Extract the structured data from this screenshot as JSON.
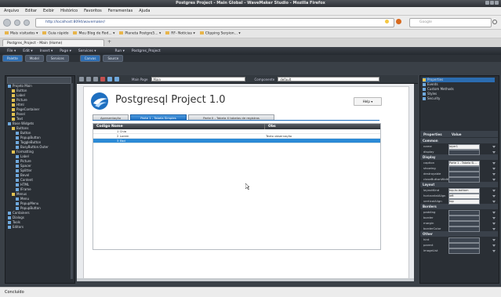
{
  "window": {
    "title": "Postgres Project - Main Global - WaveMaker Studio - Mozilla Firefox"
  },
  "menu": [
    "Arquivo",
    "Editar",
    "Exibir",
    "Histórico",
    "Favoritos",
    "Ferramentas",
    "Ajuda"
  ],
  "nav": {
    "url": "http://localhost:8094/wavemaker/",
    "search_placeholder": "Google"
  },
  "bookmarks": [
    "Mais visitados ▾",
    "Guia rápido",
    "Meu Blog de Rod... ▾",
    "Planeta Postgre5... ▾",
    "RF- Notícias ▾",
    "Clipping Serpion... ▾"
  ],
  "browser_tab": "Postgres_Project - Main (Home)",
  "studio": {
    "menus": [
      "File ▾",
      "Edit ▾",
      "Insert ▾",
      "Page ▾",
      "Services ▾",
      "Run ▾",
      "Postgres_Project"
    ],
    "tabs": [
      "Palette",
      "Model",
      "Services",
      "Canvas",
      "Source"
    ],
    "toolbar": {
      "page_label": "Main Page",
      "page_value": "Main",
      "theme_label": "Componente",
      "theme_value": "default"
    }
  },
  "tree": [
    {
      "label": "Projeto Main",
      "level": 0,
      "color": "#6fa8dc"
    },
    {
      "label": "Button",
      "level": 1,
      "color": "#e0c050"
    },
    {
      "label": "Label",
      "level": 1,
      "color": "#e0c050"
    },
    {
      "label": "Picture",
      "level": 1,
      "color": "#e0c050"
    },
    {
      "label": "Html",
      "level": 1,
      "color": "#e0c050"
    },
    {
      "label": "PageContainer",
      "level": 1,
      "color": "#e0c050"
    },
    {
      "label": "Panel",
      "level": 1,
      "color": "#e0c050"
    },
    {
      "label": "Text",
      "level": 1,
      "color": "#e0c050"
    },
    {
      "label": "Base Widgets",
      "level": 0,
      "color": "#6fa8dc"
    },
    {
      "label": "Buttons",
      "level": 1,
      "color": "#e0c050"
    },
    {
      "label": "Button",
      "level": 2,
      "color": "#6fa8dc"
    },
    {
      "label": "PopupButton",
      "level": 2,
      "color": "#6fa8dc"
    },
    {
      "label": "ToggleButton",
      "level": 2,
      "color": "#6fa8dc"
    },
    {
      "label": "BusyButton.Outer",
      "level": 2,
      "color": "#6fa8dc"
    },
    {
      "label": "Formatting",
      "level": 1,
      "color": "#e0c050"
    },
    {
      "label": "Label",
      "level": 2,
      "color": "#6fa8dc"
    },
    {
      "label": "Picture",
      "level": 2,
      "color": "#6fa8dc"
    },
    {
      "label": "Spacer",
      "level": 2,
      "color": "#6fa8dc"
    },
    {
      "label": "Splitter",
      "level": 2,
      "color": "#6fa8dc"
    },
    {
      "label": "Bevel",
      "level": 2,
      "color": "#6fa8dc"
    },
    {
      "label": "Content",
      "level": 2,
      "color": "#6fa8dc"
    },
    {
      "label": "HTML",
      "level": 2,
      "color": "#6fa8dc"
    },
    {
      "label": "IFrame",
      "level": 2,
      "color": "#6fa8dc"
    },
    {
      "label": "Menus",
      "level": 1,
      "color": "#e0c050"
    },
    {
      "label": "Menu",
      "level": 2,
      "color": "#6fa8dc"
    },
    {
      "label": "PopupMenu",
      "level": 2,
      "color": "#6fa8dc"
    },
    {
      "label": "PopupButton",
      "level": 2,
      "color": "#6fa8dc"
    },
    {
      "label": "Containers",
      "level": 0,
      "color": "#6fa8dc"
    },
    {
      "label": "Dialogs",
      "level": 0,
      "color": "#6fa8dc"
    },
    {
      "label": "Tools",
      "level": 0,
      "color": "#6fa8dc"
    },
    {
      "label": "Editors",
      "level": 0,
      "color": "#6fa8dc"
    }
  ],
  "app": {
    "title": "Postgresql Project 1.0",
    "help": "Help ▾",
    "tabs": [
      "Apresentação",
      "Parte 1 - Tabela Simples",
      "Parte II - Tabela X tabelas de registros"
    ],
    "active_tab": 1,
    "grid": {
      "columns": [
        "Codigo Nome",
        "Obs"
      ],
      "rows": [
        {
          "codigo": "1 Chia",
          "obs": ""
        },
        {
          "codigo": "2 Lorem",
          "obs": "Texto observação"
        },
        {
          "codigo": "3 Ebd",
          "obs": ""
        }
      ],
      "selected_row": 2
    }
  },
  "props": {
    "tree_items": [
      "Properties",
      "Events",
      "Custom Methods",
      "Styles",
      "Security"
    ],
    "header_left": "Properties",
    "header_right": "Value",
    "sections": [
      {
        "title": "Common",
        "rows": [
          {
            "k": "name",
            "v": "layer1"
          },
          {
            "k": "display",
            "v": ""
          }
        ]
      },
      {
        "title": "Display",
        "rows": [
          {
            "k": "caption",
            "v": "Parte 1 - Tabela Si..."
          },
          {
            "k": "showing",
            "v": ""
          },
          {
            "k": "destroyable",
            "v": ""
          },
          {
            "k": "closeButtonWidth",
            "v": ""
          }
        ]
      },
      {
        "title": "Layout",
        "rows": [
          {
            "k": "layoutKind",
            "v": "top-to-bottom"
          },
          {
            "k": "horizontalAlign",
            "v": "left"
          },
          {
            "k": "verticalAlign",
            "v": "top"
          }
        ]
      },
      {
        "title": "Borders",
        "rows": [
          {
            "k": "padding",
            "v": ""
          },
          {
            "k": "border",
            "v": ""
          },
          {
            "k": "margin",
            "v": ""
          },
          {
            "k": "borderColor",
            "v": ""
          }
        ]
      },
      {
        "title": "Other",
        "rows": [
          {
            "k": "hint",
            "v": ""
          },
          {
            "k": "parent",
            "v": ""
          },
          {
            "k": "imageList",
            "v": ""
          }
        ]
      }
    ]
  },
  "status": "Concluído"
}
